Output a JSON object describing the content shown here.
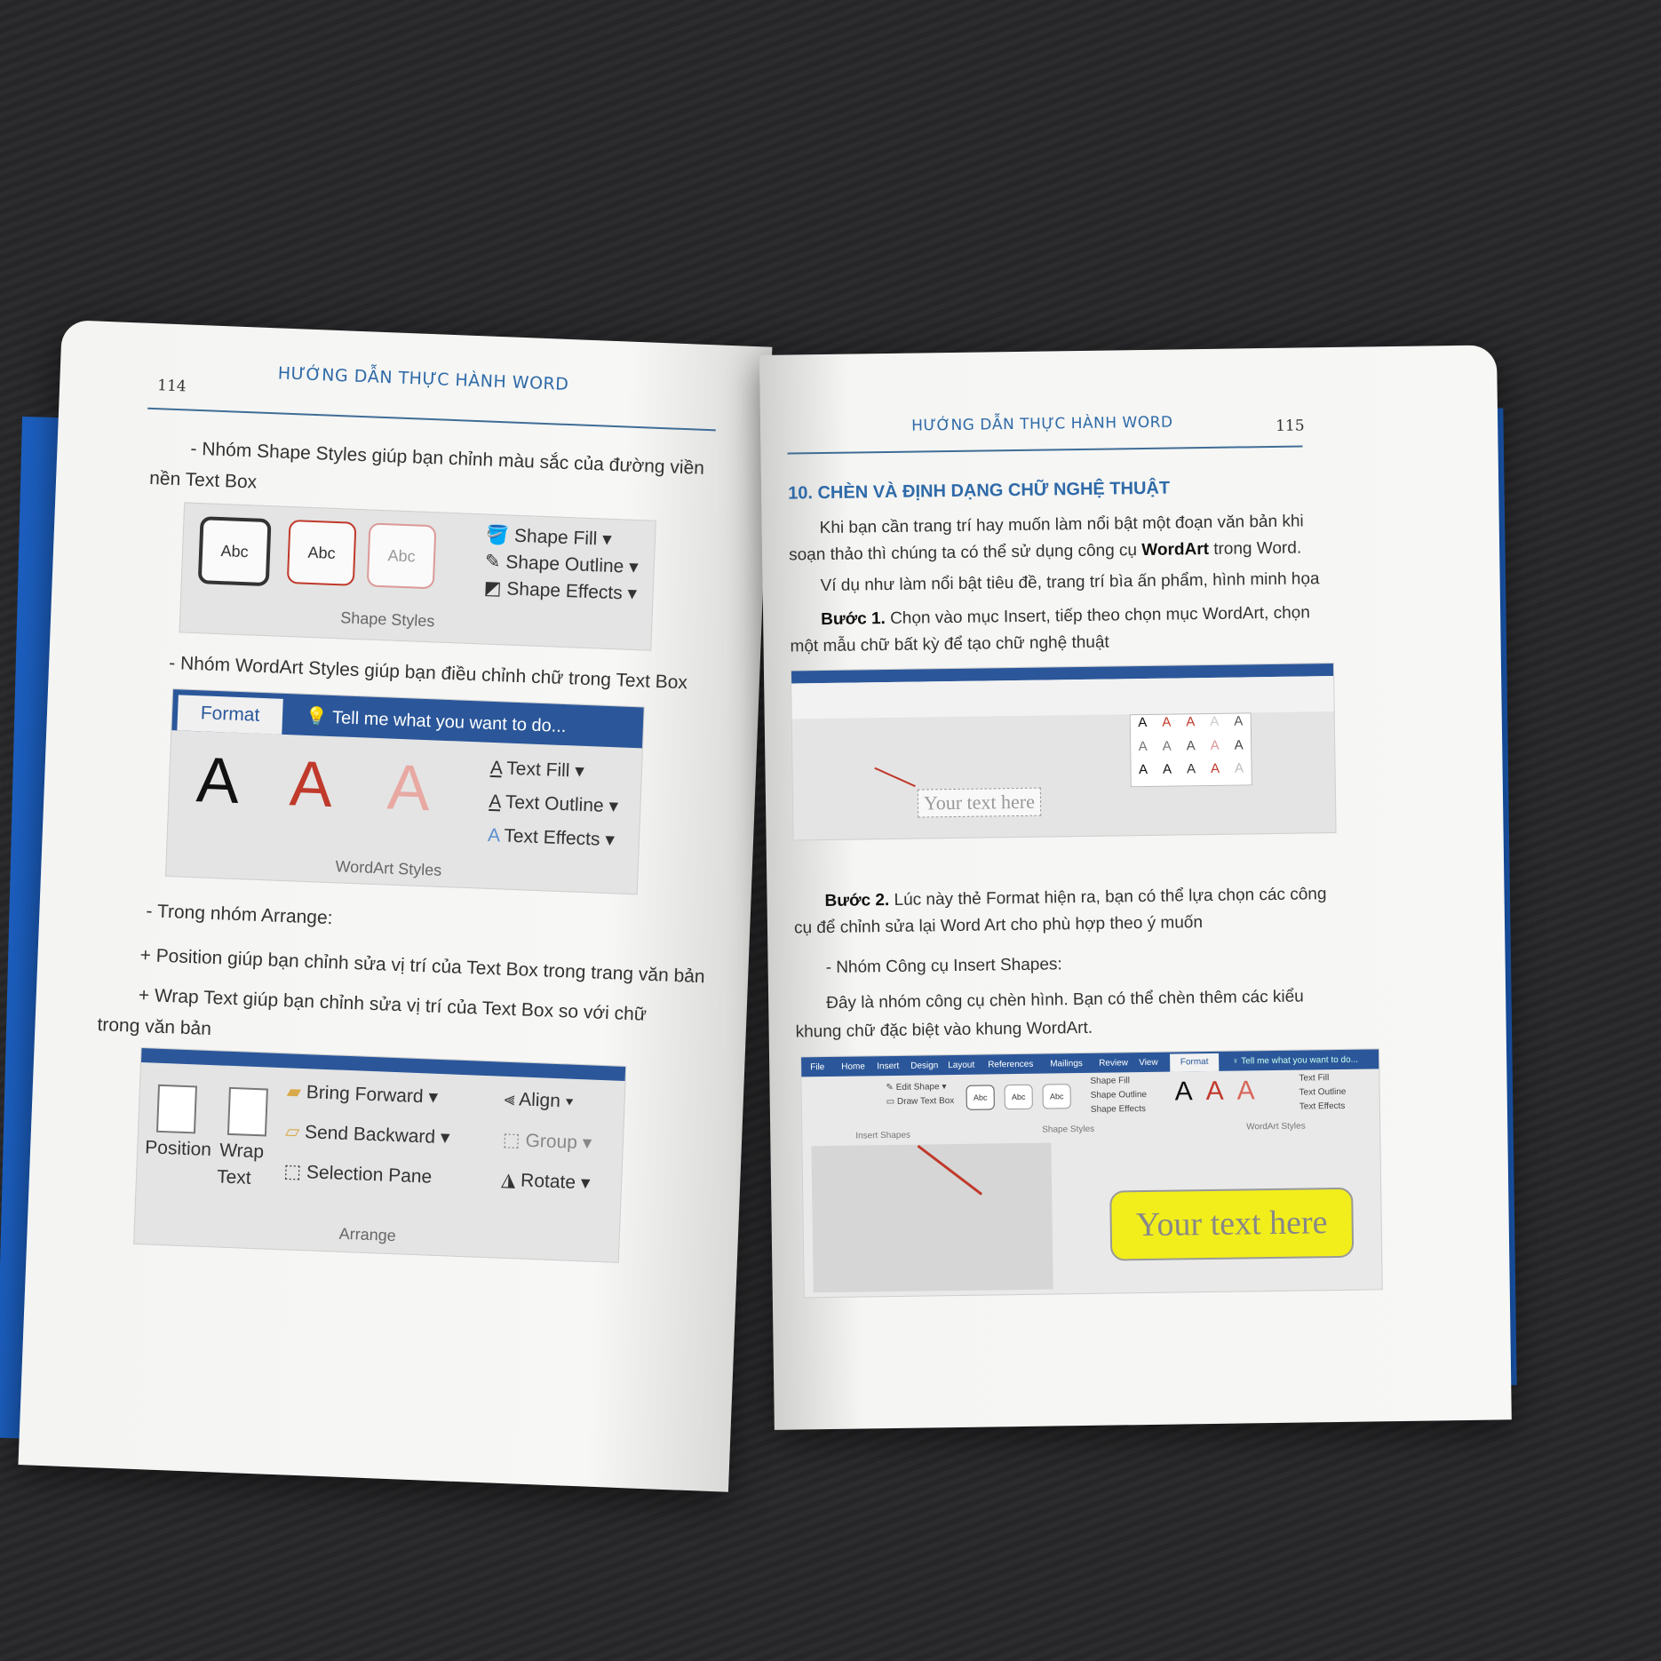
{
  "left_page": {
    "page_number": "114",
    "header": "HƯỚNG DẪN THỰC HÀNH WORD",
    "para1_line1": "- Nhóm Shape Styles giúp bạn chỉnh màu sắc của đường viền",
    "para1_line2": "nền Text Box",
    "shape_styles": {
      "samples": [
        "Abc",
        "Abc",
        "Abc"
      ],
      "commands": [
        "Shape Fill",
        "Shape Outline",
        "Shape Effects"
      ],
      "group_label": "Shape Styles"
    },
    "para2": "- Nhóm WordArt Styles giúp bạn điều chỉnh chữ trong Text Box",
    "wordart_styles": {
      "tab": "Format",
      "tell_me": "Tell me what you want to do...",
      "samples": [
        "A",
        "A",
        "A"
      ],
      "commands": [
        "Text Fill",
        "Text Outline",
        "Text Effects"
      ],
      "group_label": "WordArt Styles"
    },
    "para3": "- Trong nhóm Arrange:",
    "para4": "+ Position giúp bạn chỉnh sửa vị trí của Text Box trong trang văn bản",
    "para5_line1": "+ Wrap Text giúp bạn chỉnh sửa vị trí của Text Box so với chữ",
    "para5_line2": "trong văn bản",
    "arrange": {
      "position": "Position",
      "wrap_text_1": "Wrap",
      "wrap_text_2": "Text",
      "bring_forward": "Bring Forward",
      "send_backward": "Send Backward",
      "selection_pane": "Selection Pane",
      "align": "Align",
      "group": "Group",
      "rotate": "Rotate",
      "group_label": "Arrange"
    }
  },
  "right_page": {
    "page_number": "115",
    "header": "HƯỚNG DẪN THỰC HÀNH WORD",
    "section_title": "10. CHÈN VÀ ĐỊNH DẠNG CHỮ NGHỆ THUẬT",
    "p1_line1": "Khi bạn cần trang trí hay muốn làm nổi bật một đoạn văn bản khi",
    "p1_line2a": "soạn thảo thì chúng ta có thể sử dụng công cụ ",
    "p1_bold": "WordArt",
    "p1_line2b": " trong Word.",
    "p2": "Ví dụ như làm nổi bật tiêu đề, trang trí bìa ấn phẩm, hình minh họa",
    "step1_label": "Bước 1.",
    "step1_line1": " Chọn vào mục Insert, tiếp theo chọn mục WordArt, chọn",
    "step1_line2": "một mẫu chữ bất kỳ để tạo chữ nghệ thuật",
    "shot1": {
      "placeholder": "Your text here",
      "gallery": [
        "A",
        "A",
        "A",
        "A",
        "A",
        "A",
        "A",
        "A",
        "A",
        "A",
        "A",
        "A",
        "A",
        "A",
        "A"
      ]
    },
    "step2_label": "Bước 2.",
    "step2_line1": " Lúc này thẻ Format hiện ra, bạn có thể lựa chọn các công",
    "step2_line2": "cụ để chỉnh sửa lại Word Art cho phù hợp theo ý muốn",
    "p3": "- Nhóm Công cụ Insert Shapes:",
    "p4_line1": "Đây là nhóm công cụ chèn hình. Bạn có thể chèn thêm các kiểu",
    "p4_line2": "khung chữ đặc biệt vào khung WordArt.",
    "shot2": {
      "tabs": [
        "File",
        "Home",
        "Insert",
        "Design",
        "Layout",
        "References",
        "Mailings",
        "Review",
        "View"
      ],
      "active_tab": "Format",
      "tell_me": "Tell me what you want to do...",
      "edit_shape": "Edit Shape",
      "draw_text_box": "Draw Text Box",
      "insert_shapes_label": "Insert Shapes",
      "abc": [
        "Abc",
        "Abc",
        "Abc"
      ],
      "shape_cmds": [
        "Shape Fill",
        "Shape Outline",
        "Shape Effects"
      ],
      "shape_styles_label": "Shape Styles",
      "wordart": [
        "A",
        "A",
        "A"
      ],
      "text_cmds": [
        "Text Fill",
        "Text Outline",
        "Text Effects"
      ],
      "wordart_label": "WordArt Styles",
      "textbox_text": "Your text here"
    }
  },
  "colors": {
    "header_blue": "#2f6aa8",
    "ribbon_blue": "#2b579a",
    "cover_blue": "#1c5fc0",
    "highlight_yellow": "#f2ee1c",
    "wordart_red": "#c0392b"
  }
}
